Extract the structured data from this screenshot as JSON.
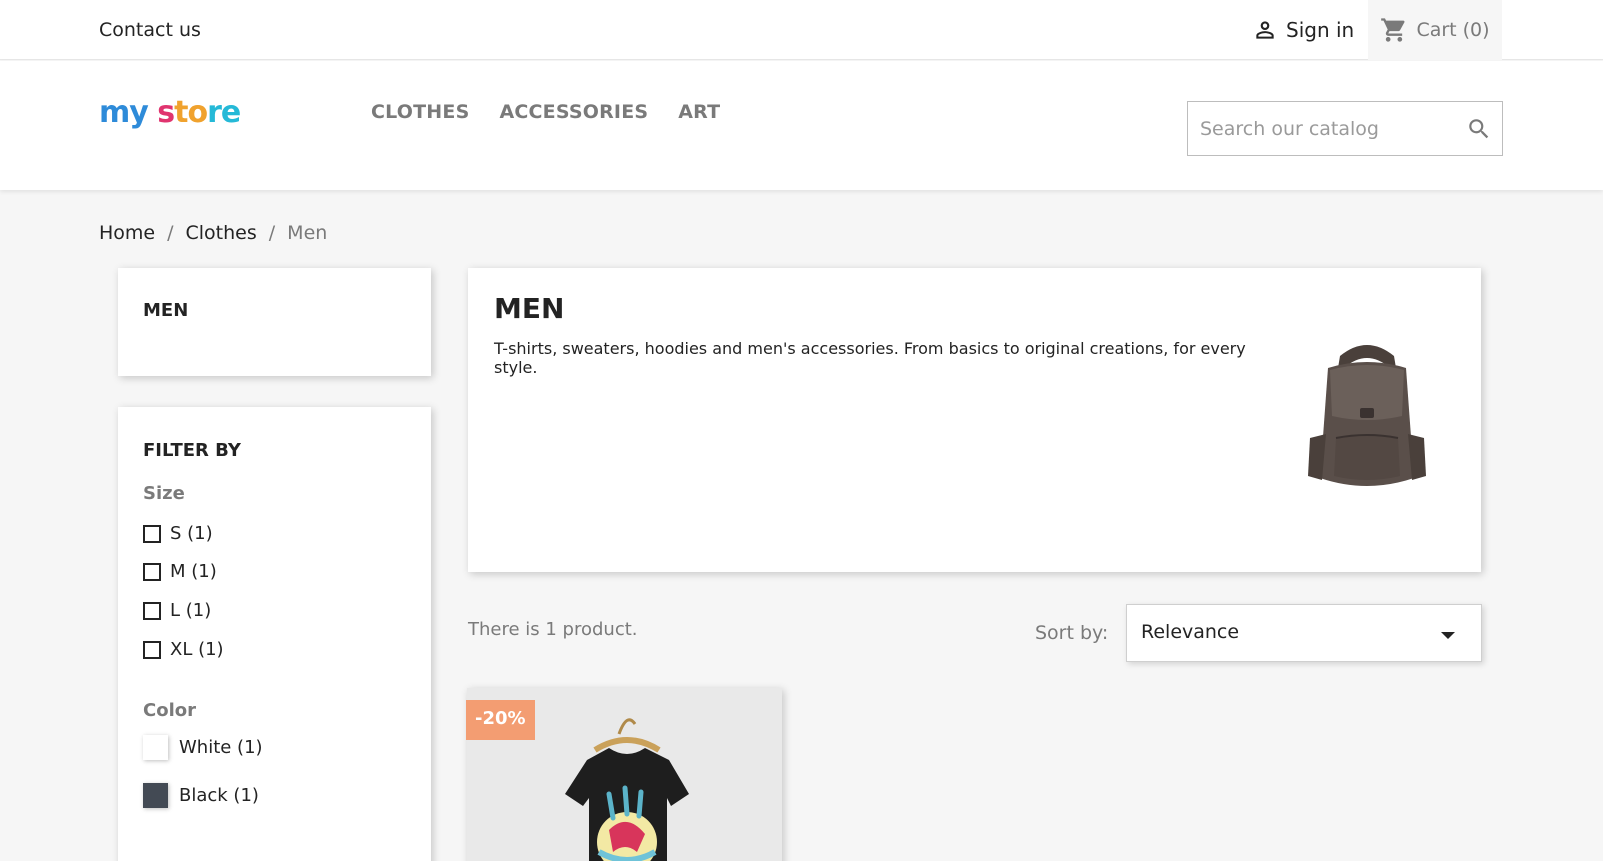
{
  "topbar": {
    "contact": "Contact us",
    "signin": "Sign in",
    "cart": "Cart (0)"
  },
  "header": {
    "logo": {
      "part1": "my",
      "part2": "s",
      "part3": "to",
      "part4": "re"
    },
    "nav": [
      "CLOTHES",
      "ACCESSORIES",
      "ART"
    ],
    "search_placeholder": "Search our catalog"
  },
  "breadcrumb": {
    "items": [
      "Home",
      "Clothes",
      "Men"
    ],
    "separator": "/"
  },
  "left": {
    "category_title": "MEN",
    "filter_title": "FILTER BY",
    "size": {
      "title": "Size",
      "options": [
        "S (1)",
        "M (1)",
        "L (1)",
        "XL (1)"
      ]
    },
    "color": {
      "title": "Color",
      "options": [
        {
          "label": "White (1)",
          "color": "#ffffff"
        },
        {
          "label": "Black (1)",
          "color": "#434a54"
        }
      ]
    }
  },
  "category": {
    "title": "MEN",
    "description": "T-shirts, sweaters, hoodies and men's accessories. From basics to original creations, for every style."
  },
  "products": {
    "count_text": "There is 1 product.",
    "sort_label": "Sort by:",
    "sort_value": "Relevance",
    "items": [
      {
        "discount": "-20%"
      }
    ]
  }
}
